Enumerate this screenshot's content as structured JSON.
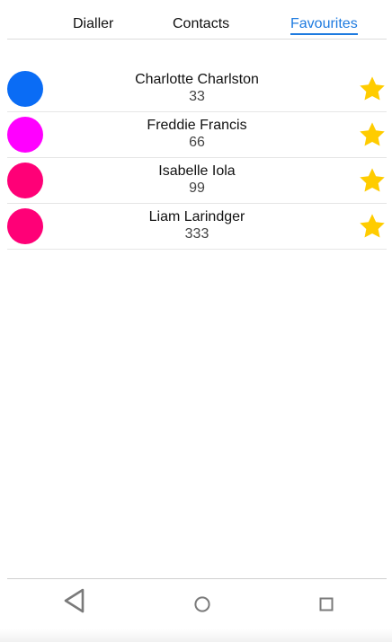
{
  "tabs": {
    "dialler": "Dialler",
    "contacts": "Contacts",
    "favourites": "Favourites",
    "active": "Favourites",
    "active_color": "#1e7be0"
  },
  "favourites": [
    {
      "name": "Charlotte Charlston",
      "number": "33",
      "avatar_color": "#0a6cf5",
      "starred": true
    },
    {
      "name": "Freddie Francis",
      "number": "66",
      "avatar_color": "#ff00ff",
      "starred": true
    },
    {
      "name": "Isabelle Iola",
      "number": "99",
      "avatar_color": "#ff0077",
      "starred": true
    },
    {
      "name": "Liam Larindger",
      "number": "333",
      "avatar_color": "#ff0077",
      "starred": true
    }
  ],
  "colors": {
    "star": "#ffcc00"
  },
  "navbar": {
    "back_icon": "back-triangle-icon",
    "home_icon": "home-circle-icon",
    "recent_icon": "recent-apps-square-icon"
  }
}
